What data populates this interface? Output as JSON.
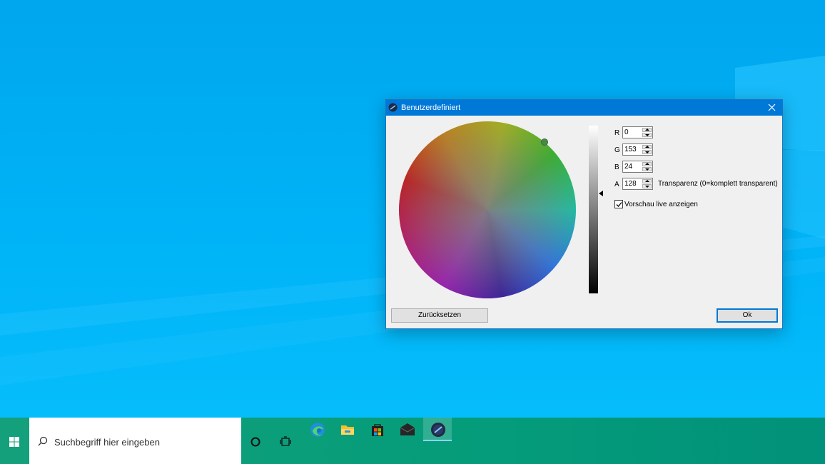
{
  "dialog": {
    "title": "Benutzerdefiniert",
    "close_icon": "close-icon",
    "fields": [
      {
        "label": "R",
        "value": "0"
      },
      {
        "label": "G",
        "value": "153"
      },
      {
        "label": "B",
        "value": "24"
      },
      {
        "label": "A",
        "value": "128"
      }
    ],
    "alpha_hint": "Transparenz (0=komplett transparent)",
    "live_preview_label": "Vorschau live anzeigen",
    "live_preview_checked": true,
    "reset_button": "Zurücksetzen",
    "ok_button": "Ok"
  },
  "taskbar": {
    "search_placeholder": "Suchbegriff hier eingeben",
    "apps": [
      "edge-icon",
      "file-explorer-icon",
      "store-icon",
      "mail-icon",
      "color-picker-app-icon"
    ]
  },
  "colors": {
    "titlebar": "#0078d7",
    "taskbar": "#049c7a",
    "desktop": "#00b4f8"
  }
}
